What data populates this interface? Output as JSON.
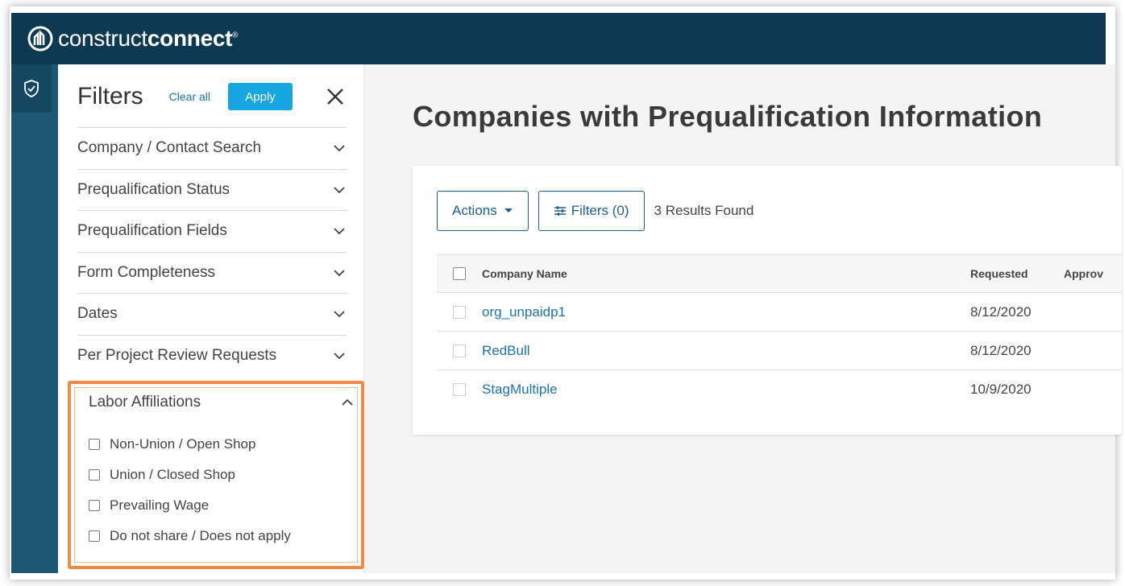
{
  "brand": {
    "name_thin": "construct",
    "name_bold": "connect",
    "mark": "®"
  },
  "filters": {
    "title": "Filters",
    "clear_all": "Clear all",
    "apply": "Apply",
    "sections": [
      {
        "label": "Company / Contact Search"
      },
      {
        "label": "Prequalification Status"
      },
      {
        "label": "Prequalification Fields"
      },
      {
        "label": "Form Completeness"
      },
      {
        "label": "Dates"
      },
      {
        "label": "Per Project Review Requests"
      }
    ],
    "labor": {
      "label": "Labor Affiliations",
      "options": [
        {
          "label": "Non-Union / Open Shop"
        },
        {
          "label": "Union / Closed Shop"
        },
        {
          "label": "Prevailing Wage"
        },
        {
          "label": "Do not share / Does not apply"
        }
      ]
    }
  },
  "main": {
    "title": "Companies with Prequalification Information",
    "actions_label": "Actions",
    "filters_label": "Filters (0)",
    "results": "3 Results Found",
    "columns": {
      "name": "Company Name",
      "requested": "Requested",
      "approved": "Approv"
    },
    "rows": [
      {
        "name": "org_unpaidp1",
        "requested": "8/12/2020"
      },
      {
        "name": "RedBull",
        "requested": "8/12/2020"
      },
      {
        "name": "StagMultiple",
        "requested": "10/9/2020"
      }
    ]
  },
  "colors": {
    "topbar": "#0d3a52",
    "rail": "#1e5676",
    "apply": "#17a7e0",
    "link": "#1a74a8",
    "highlight": "#f28a4a"
  }
}
